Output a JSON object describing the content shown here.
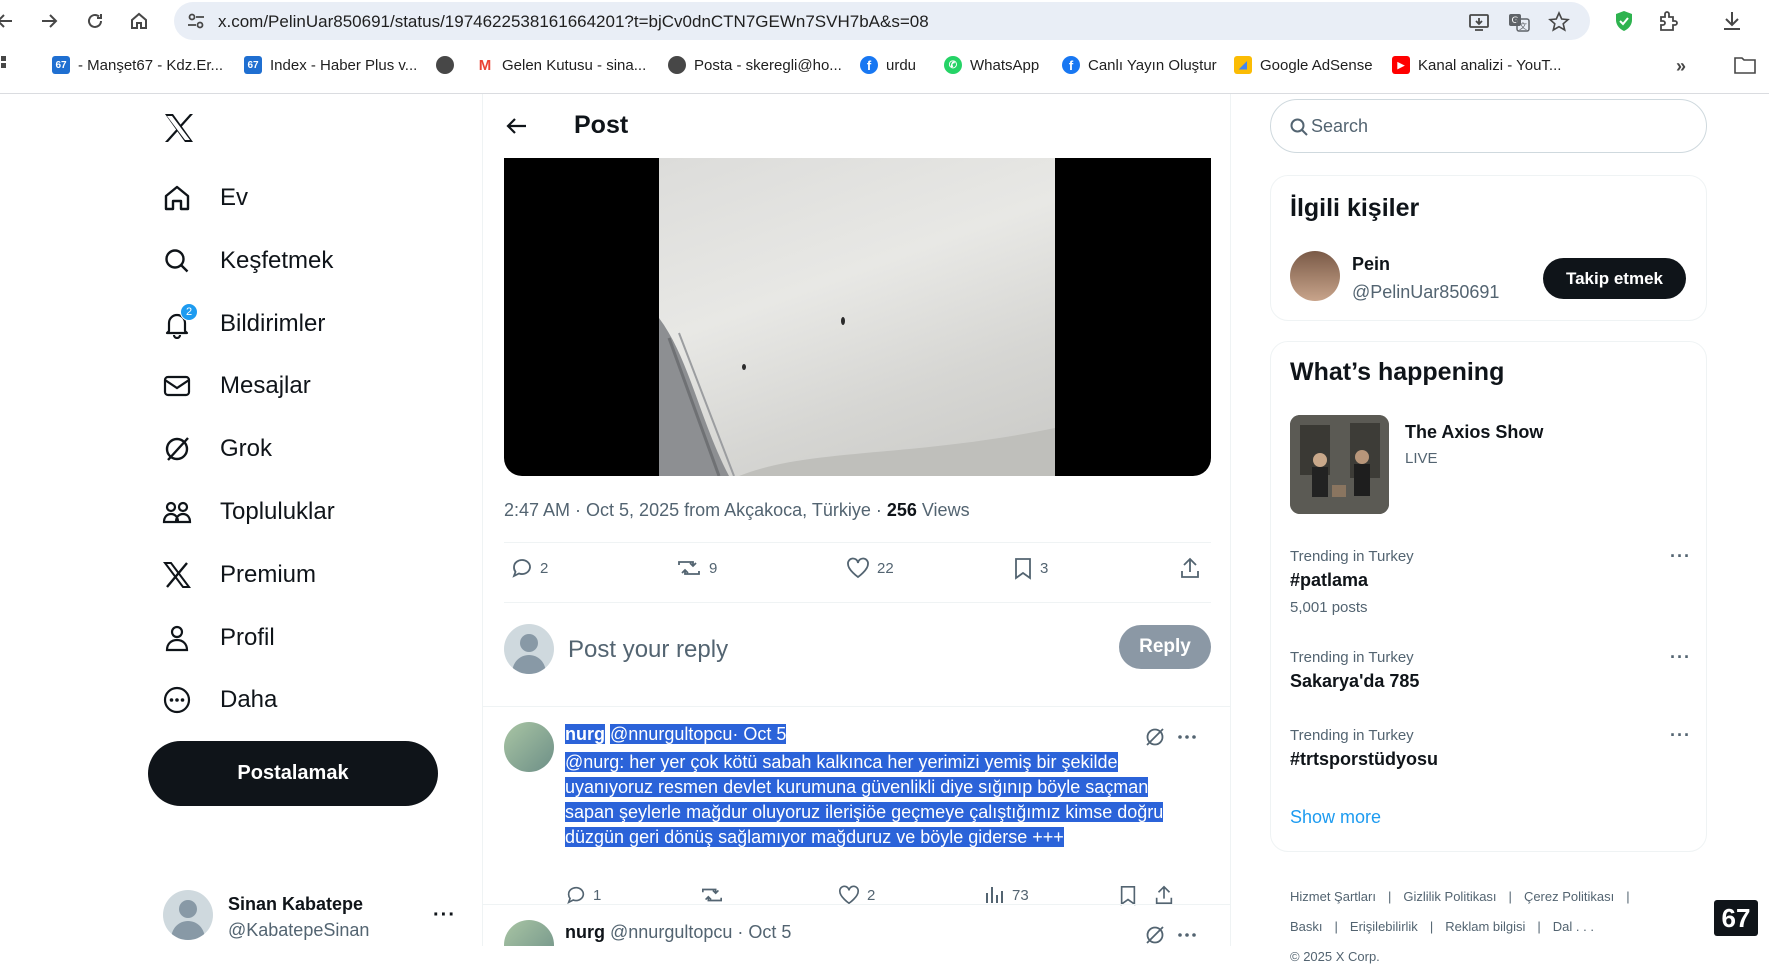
{
  "browser": {
    "url": "x.com/PelinUar850691/status/1974622538161664201?t=bjCv0dnCTN7GEWn7SVH7bA&s=08",
    "bookmarks": [
      {
        "label": "- Manşet67 - Kdz.Er...",
        "icon": "67-favicon",
        "color": "#1f6fd1",
        "glyph": "67"
      },
      {
        "label": "Index - Haber Plus v...",
        "icon": "67-favicon",
        "color": "#1f6fd1",
        "glyph": "67"
      },
      {
        "label": "",
        "icon": "globe-icon",
        "color": "#474747",
        "glyph": "🌐"
      },
      {
        "label": "Gelen Kutusu - sina...",
        "icon": "gmail-icon",
        "color": "#ea4335",
        "glyph": "M"
      },
      {
        "label": "Posta - skeregli@ho...",
        "icon": "globe-icon",
        "color": "#474747",
        "glyph": "🌐"
      },
      {
        "label": "urdu",
        "icon": "facebook-icon",
        "color": "#1877f2",
        "glyph": "f"
      },
      {
        "label": "WhatsApp",
        "icon": "whatsapp-icon",
        "color": "#25d366",
        "glyph": "✆"
      },
      {
        "label": "Canlı Yayın Oluştur",
        "icon": "facebook-icon",
        "color": "#1877f2",
        "glyph": "f"
      },
      {
        "label": "Google AdSense",
        "icon": "adsense-icon",
        "color": "#fbbc04",
        "glyph": "◢"
      },
      {
        "label": "Kanal analizi - YouT...",
        "icon": "youtube-icon",
        "color": "#ff0000",
        "glyph": "▶"
      }
    ]
  },
  "nav": {
    "items": [
      {
        "label": "Ev",
        "icon": "home-icon"
      },
      {
        "label": "Keşfetmek",
        "icon": "search-icon"
      },
      {
        "label": "Bildirimler",
        "icon": "bell-icon",
        "badge": "2"
      },
      {
        "label": "Mesajlar",
        "icon": "mail-icon"
      },
      {
        "label": "Grok",
        "icon": "grok-icon"
      },
      {
        "label": "Topluluklar",
        "icon": "communities-icon"
      },
      {
        "label": "Premium",
        "icon": "x-logo-icon"
      },
      {
        "label": "Profil",
        "icon": "profile-icon"
      },
      {
        "label": "Daha",
        "icon": "more-circle-icon"
      }
    ],
    "post_button": "Postalamak",
    "account": {
      "name": "Sinan Kabatepe",
      "handle": "@KabatepeSinan",
      "more": "···"
    }
  },
  "main": {
    "title": "Post",
    "meta": {
      "time": "2:47 AM · Oct 5, 2025 from Akçakoca, Türkiye · ",
      "views_count": "256",
      "views_label": " Views"
    },
    "actions": {
      "replies": "2",
      "reposts": "9",
      "likes": "22",
      "bookmarks": "3"
    },
    "reply_box": {
      "placeholder": "Post your reply",
      "button": "Reply"
    },
    "replies": [
      {
        "name": "nurg",
        "handle": "@nnurgultopcu",
        "date": "· Oct 5",
        "text": "@nurg: her yer çok kötü sabah kalkınca her yerimizi yemiş bir şekilde uyanıyoruz resmen devlet kurumuna güvenlikli diye sığınıp böyle saçman sapan şeylerle mağdur oluyoruz ilerişiöe geçmeye çalıştığımız kimse doğru düzgün geri dönüş sağlamıyor mağduruz ve böyle giderse +++",
        "replies": "1",
        "reposts": "",
        "likes": "2",
        "views": "73",
        "selected": true
      },
      {
        "name": "nurg",
        "handle": "@nnurgultopcu",
        "date": "· Oct 5"
      }
    ]
  },
  "sidebar": {
    "search_placeholder": "Search",
    "related": {
      "title": "İlgili kişiler",
      "name": "Pein",
      "handle": "@PelinUar850691",
      "follow": "Takip etmek"
    },
    "happening": {
      "title": "What’s happening",
      "live": {
        "title": "The Axios Show",
        "badge": "LIVE"
      },
      "trends": [
        {
          "context": "Trending in Turkey",
          "topic": "#patlama",
          "count": "5,001 posts"
        },
        {
          "context": "Trending in Turkey",
          "topic": "Sakarya'da 785",
          "count": ""
        },
        {
          "context": "Trending in Turkey",
          "topic": "#trtsporstüdyosu",
          "count": ""
        }
      ],
      "show_more": "Show more"
    },
    "footer": [
      "Hizmet Şartları",
      "|",
      "Gizlilik Politikası",
      "|",
      "Çerez Politikası",
      "|",
      "Baskı",
      "|",
      "Erişilebilirlik",
      "|",
      "Reklam bilgisi",
      "|",
      "Dal . . .",
      "© 2025 X Corp."
    ],
    "corner_badge": "67"
  },
  "colors": {
    "accent": "#1d9bf0",
    "selection": "#2b63d9",
    "dark": "#0f1419"
  }
}
